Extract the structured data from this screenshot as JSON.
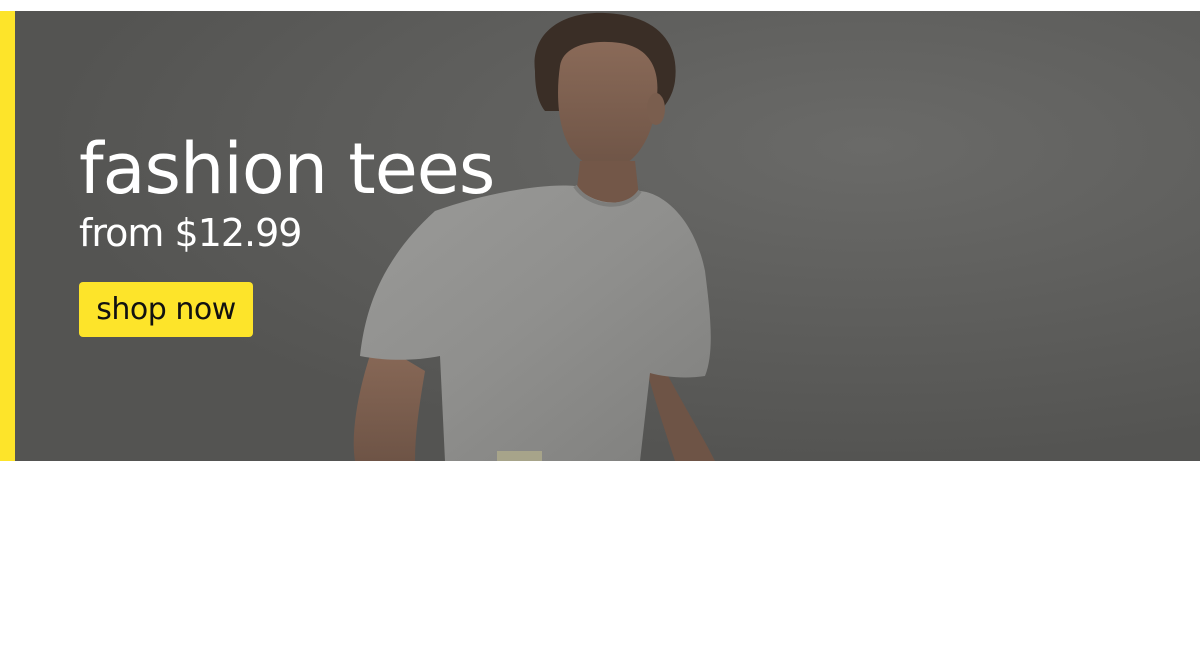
{
  "hero": {
    "headline": "fashion tees",
    "subline": "from $12.99",
    "cta_label": "shop now",
    "image_icon": "model-in-white-tee"
  },
  "colors": {
    "accent": "#fde42a",
    "overlay": "#575755",
    "text": "#ffffff",
    "button_text": "#111111"
  }
}
